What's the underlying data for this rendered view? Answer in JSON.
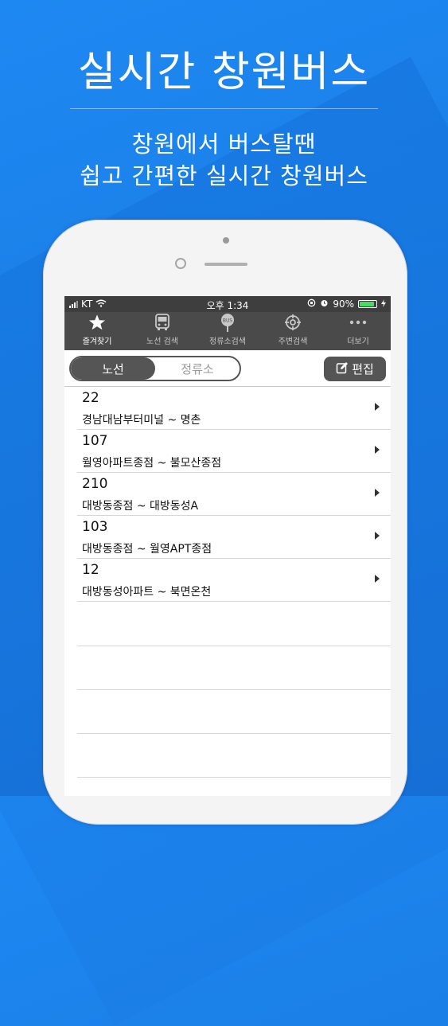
{
  "promo": {
    "headline": "실시간 창원버스",
    "sub_line1": "창원에서 버스탈땐",
    "sub_line2": "쉽고 간편한 실시간 창원버스"
  },
  "statusbar": {
    "carrier": "KT",
    "time": "오후 1:34",
    "battery": "90%",
    "battery_level": 0.9
  },
  "tabs": [
    {
      "label": "즐겨찾기",
      "icon": "star-icon",
      "active": true
    },
    {
      "label": "노선 검색",
      "icon": "bus-icon",
      "active": false
    },
    {
      "label": "정류소검색",
      "icon": "bus-stop-icon",
      "active": false
    },
    {
      "label": "주변검색",
      "icon": "crosshair-icon",
      "active": false
    },
    {
      "label": "더보기",
      "icon": "more-icon",
      "active": false
    }
  ],
  "bus_stop_badge": "BUS",
  "segment": {
    "route": "노선",
    "stop": "정류소"
  },
  "edit_label": "편집",
  "routes": [
    {
      "number": "22",
      "desc": "경남대남부터미널 ~ 명촌"
    },
    {
      "number": "107",
      "desc": "월영아파트종점 ~ 불모산종점"
    },
    {
      "number": "210",
      "desc": "대방동종점 ~ 대방동성A"
    },
    {
      "number": "103",
      "desc": "대방동종점 ~ 월영APT종점"
    },
    {
      "number": "12",
      "desc": "대방동성아파트 ~ 북면온천"
    }
  ],
  "colors": {
    "background": "#1e88f2",
    "bar_dark": "#3e3e3e",
    "tab_bg": "#4a4a4a",
    "battery_green": "#4cd964"
  }
}
